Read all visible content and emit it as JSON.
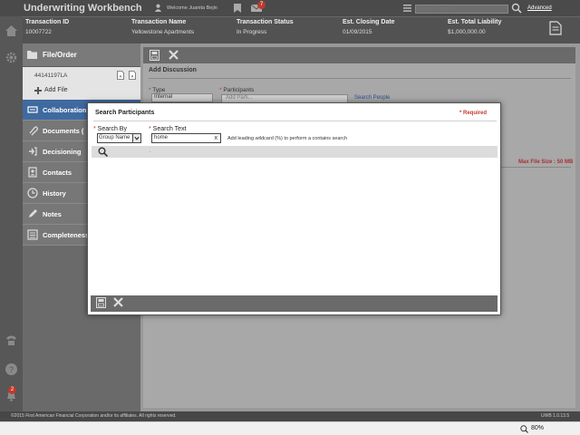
{
  "header": {
    "app_title": "Underwriting Workbench",
    "welcome": "Welcome Juanita Bejin",
    "mail_count": "7",
    "search_placeholder": "Search Content",
    "advanced_label": "Advanced"
  },
  "transaction": {
    "id_label": "Transaction ID",
    "id_value": "10007722",
    "name_label": "Transaction Name",
    "name_value": "Yellowstone Apartments",
    "status_label": "Transaction Status",
    "status_value": "In Progress",
    "closing_label": "Est. Closing Date",
    "closing_value": "01/09/2015",
    "liability_label": "Est. Total Liability",
    "liability_value": "$1,000,000.00"
  },
  "sidemenu": {
    "file_order_label": "File/Order",
    "file_number": "44141197LA",
    "add_file_label": "Add File",
    "items": [
      {
        "label": "Collaboration"
      },
      {
        "label": "Documents ("
      },
      {
        "label": "Decisioning"
      },
      {
        "label": "Contacts"
      },
      {
        "label": "History"
      },
      {
        "label": "Notes"
      },
      {
        "label": "Completeness"
      }
    ]
  },
  "rail": {
    "notification_count": "2"
  },
  "add_discussion": {
    "title": "Add Discussion",
    "type_label": "Type",
    "type_value": "Internal",
    "participants_label": "Participants",
    "participants_placeholder": "Add Parti...",
    "search_people": "Search People",
    "max_file_size": "Max File Size : 50 MB"
  },
  "modal": {
    "title": "Search Participants",
    "required_label": "* Required",
    "search_by_label": "Search By",
    "search_by_value": "Group Name",
    "search_text_label": "Search Text",
    "search_text_value": "home",
    "clear_label": "x",
    "hint": "Add leading wildcard (%) to perform a contains search",
    "results_dot": "."
  },
  "footer": {
    "copyright": "©2015 First American Financial Corporation and/or its affiliates. All rights reserved.",
    "version": "UWB 1.0.13.5"
  },
  "statusbar": {
    "zoom": "80%"
  },
  "colors": {
    "accent": "#3f6aa0",
    "required": "#c0392b",
    "header": "#4a4a4a"
  }
}
